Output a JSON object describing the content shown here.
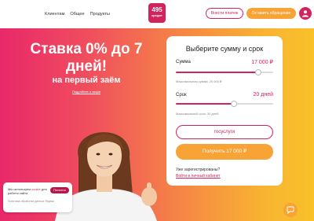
{
  "header": {
    "nav": [
      "Клиентам",
      "Общее",
      "Продукты"
    ],
    "logo_number": "495",
    "logo_word": "кредит",
    "pay_button": "Внести платеж",
    "contact_button": "Оставить обращение",
    "avatar_icon": "user-icon"
  },
  "hero": {
    "title": "Ставка 0% до 7 дней!",
    "subtitle": "на первый заём",
    "link": "Подробнее о акции"
  },
  "form": {
    "title": "Выберите сумму и срок",
    "amount_label": "Сумма",
    "amount_value": "17 000 ₽",
    "amount_fraction": 0.85,
    "amount_hint": "Максимальная сумма: 20 000 ₽",
    "term_label": "Срок",
    "term_value": "20 дней",
    "term_fraction": 0.6,
    "term_hint": "Максимальный срок: 30 дней",
    "gos_button": "госуслуги",
    "get_button": "Получить 17 000 ₽",
    "registered_q": "Уже зарегистрированы?",
    "login_link": "Войти в личный кабинет"
  },
  "cookie": {
    "text_before": "Мы используем ",
    "text_highlight": "cookie",
    "text_after": " для работы сайта",
    "ok_button": "Понятно",
    "footer": "Политика обработки данных Яндекс"
  },
  "chat_icon": "chat-icon",
  "colors": {
    "brand": "#d2235c",
    "accent": "#f7a336"
  }
}
